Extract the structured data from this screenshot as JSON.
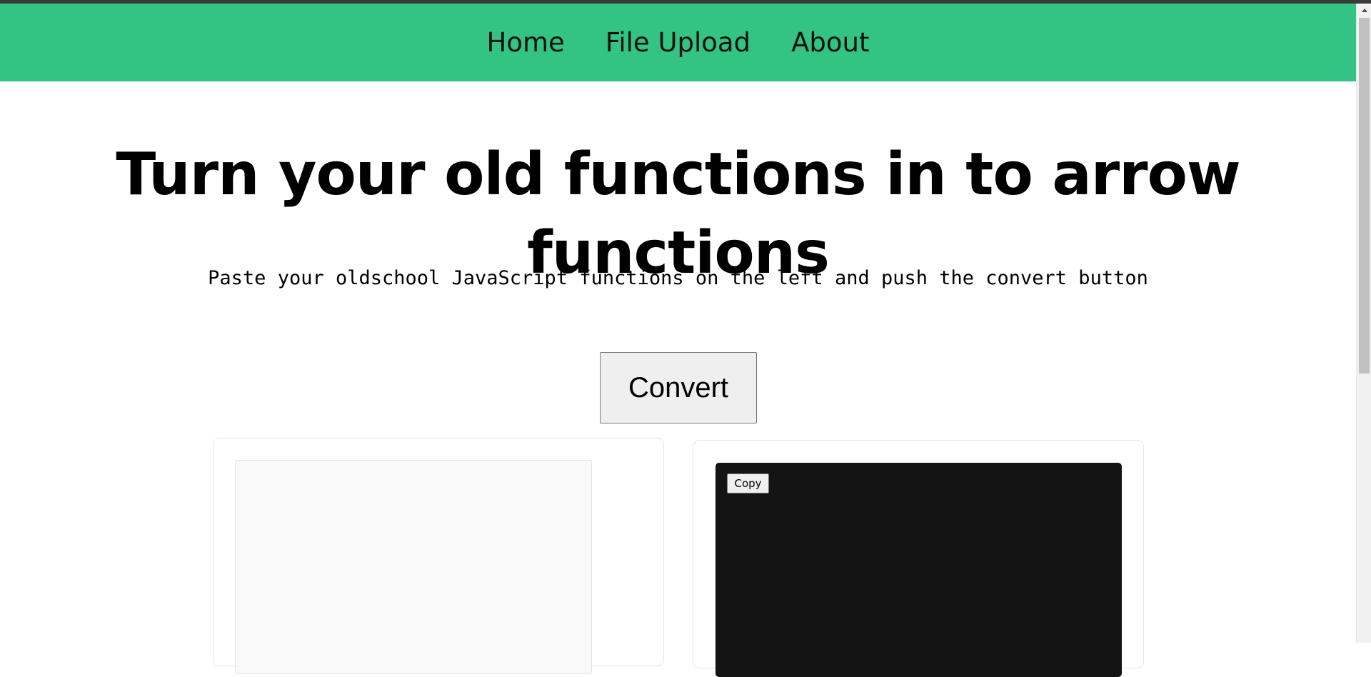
{
  "colors": {
    "nav_background": "#33c383",
    "nav_text": "#111111",
    "title_text": "#000000",
    "output_background": "#141414"
  },
  "nav": {
    "links": [
      {
        "label": "Home"
      },
      {
        "label": "File Upload"
      },
      {
        "label": "About"
      }
    ]
  },
  "main": {
    "title": "Turn your old functions in to arrow functions",
    "subtitle": "Paste your oldschool JavaScript functions on the left and push the convert button",
    "convert_label": "Convert"
  },
  "input_panel": {
    "value": "",
    "placeholder": ""
  },
  "output_panel": {
    "copy_label": "Copy",
    "value": ""
  }
}
